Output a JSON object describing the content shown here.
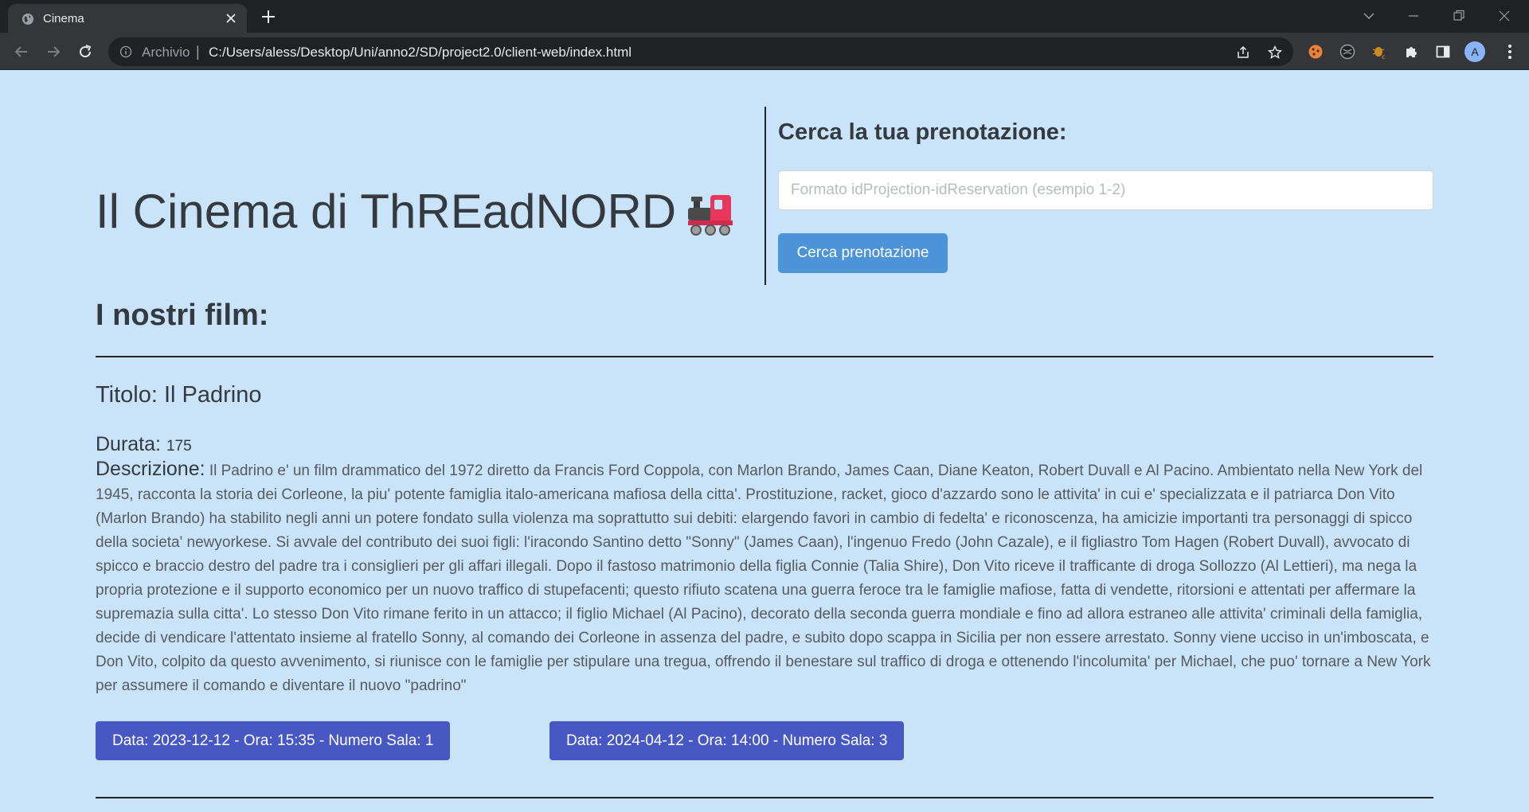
{
  "browser": {
    "tab_title": "Cinema",
    "omnibox_scheme": "Archivio",
    "omnibox_separator": "|",
    "url": "C:/Users/aless/Desktop/Uni/anno2/SD/project2.0/client-web/index.html",
    "avatar_letter": "A"
  },
  "header": {
    "site_title": "Il Cinema di ThREadNORD",
    "title_icon": "locomotive-emoji"
  },
  "search": {
    "heading": "Cerca la tua prenotazione:",
    "placeholder": "Formato idProjection-idReservation (esempio 1-2)",
    "value": "",
    "button_label": "Cerca prenotazione"
  },
  "films_section": {
    "heading": "I nostri film:",
    "films": [
      {
        "title": "Titolo: Il Padrino",
        "duration_label": "Durata:",
        "duration": "175",
        "description_label": "Descrizione:",
        "description": "Il Padrino e' un film drammatico del 1972 diretto da Francis Ford Coppola, con Marlon Brando, James Caan, Diane Keaton, Robert Duvall e Al Pacino. Ambientato nella New York del 1945, racconta la storia dei Corleone, la piu' potente famiglia italo-americana mafiosa della citta'. Prostituzione, racket, gioco d'azzardo sono le attivita' in cui e' specializzata e il patriarca Don Vito (Marlon Brando) ha stabilito negli anni un potere fondato sulla violenza ma soprattutto sui debiti: elargendo favori in cambio di fedelta' e riconoscenza, ha amicizie importanti tra personaggi di spicco della societa' newyorkese. Si avvale del contributo dei suoi figli: l'iracondo Santino detto \"Sonny\" (James Caan), l'ingenuo Fredo (John Cazale), e il figliastro Tom Hagen (Robert Duvall), avvocato di spicco e braccio destro del padre tra i consiglieri per gli affari illegali. Dopo il fastoso matrimonio della figlia Connie (Talia Shire), Don Vito riceve il trafficante di droga Sollozzo (Al Lettieri), ma nega la propria protezione e il supporto economico per un nuovo traffico di stupefacenti; questo rifiuto scatena una guerra feroce tra le famiglie mafiose, fatta di vendette, ritorsioni e attentati per affermare la supremazia sulla citta'. Lo stesso Don Vito rimane ferito in un attacco; il figlio Michael (Al Pacino), decorato della seconda guerra mondiale e fino ad allora estraneo alle attivita' criminali della famiglia, decide di vendicare l'attentato insieme al fratello Sonny, al comando dei Corleone in assenza del padre, e subito dopo scappa in Sicilia per non essere arrestato. Sonny viene ucciso in un'imboscata, e Don Vito, colpito da questo avvenimento, si riunisce con le famiglie per stipulare una tregua, offrendo il benestare sul traffico di droga e ottenendo l'incolumita' per Michael, che puo' tornare a New York per assumere il comando e diventare il nuovo \"padrino\"",
        "projections": [
          "Data: 2023-12-12 - Ora: 15:35 - Numero Sala: 1",
          "Data: 2024-04-12 - Ora: 14:00 - Numero Sala: 3"
        ]
      }
    ]
  },
  "colors": {
    "page_background": "#c9e3f9",
    "search_button": "#4c93d8",
    "projection_button": "#4758c4",
    "text_dark": "#343a40"
  }
}
